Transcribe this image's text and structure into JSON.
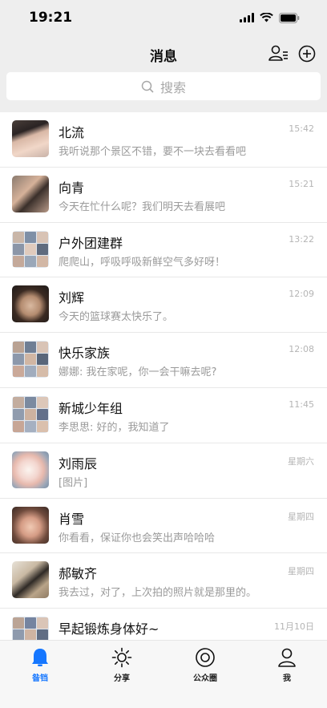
{
  "status_bar": {
    "time": "19:21"
  },
  "header": {
    "title": "消息"
  },
  "search": {
    "placeholder": "搜索"
  },
  "conversations": [
    {
      "name": "北流",
      "message": "我听说那个景区不错，要不一块去看看吧",
      "time": "15:42"
    },
    {
      "name": "向青",
      "message": "今天在忙什么呢？我们明天去看展吧",
      "time": "15:21"
    },
    {
      "name": "户外团建群",
      "message": "爬爬山，呼吸呼吸新鲜空气多好呀！",
      "time": "13:22"
    },
    {
      "name": "刘辉",
      "message": "今天的篮球赛太快乐了。",
      "time": "12:09"
    },
    {
      "name": "快乐家族",
      "message": "娜娜: 我在家呢，你一会干嘛去呢?",
      "time": "12:08"
    },
    {
      "name": "新城少年组",
      "message": "李思思: 好的，我知道了",
      "time": "11:45"
    },
    {
      "name": "刘雨辰",
      "message": "[图片]",
      "time": "星期六"
    },
    {
      "name": "肖雪",
      "message": "你看看，保证你也会笑出声哈哈哈",
      "time": "星期四"
    },
    {
      "name": "郝敏齐",
      "message": "我去过，对了，上次拍的照片就是那里的。",
      "time": "星期四"
    },
    {
      "name": "早起锻炼身体好~",
      "message": "",
      "time": "11月10日"
    }
  ],
  "tabs": [
    {
      "label": "昝铛",
      "icon": "bell-icon",
      "active": true
    },
    {
      "label": "分享",
      "icon": "sun-icon",
      "active": false
    },
    {
      "label": "公众圈",
      "icon": "circle-icon",
      "active": false
    },
    {
      "label": "我",
      "icon": "person-icon",
      "active": false
    }
  ],
  "colors": {
    "accent": "#1677ff",
    "header_bg": "#eeeeee"
  }
}
